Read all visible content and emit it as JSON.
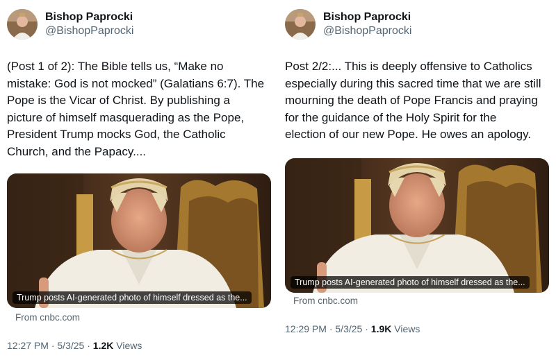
{
  "posts": [
    {
      "author": {
        "name": "Bishop Paprocki",
        "handle": "@BishopPaprocki"
      },
      "text": "(Post 1 of 2): The Bible tells us, “Make no\nmistake: God is not mocked” (Galatians 6:7). The\nPope is the Vicar of Christ. By publishing a\npicture of himself masquerading as the Pope,\nPresident Trump mocks God, the Catholic\nChurch, and the Papacy....",
      "card": {
        "caption": "Trump posts AI-generated photo of himself dressed as the...",
        "source": "From cnbc.com"
      },
      "meta": {
        "time": "12:27 PM",
        "date": "5/3/25",
        "views_count": "1.2K",
        "views_label": "Views"
      }
    },
    {
      "author": {
        "name": "Bishop Paprocki",
        "handle": "@BishopPaprocki"
      },
      "text": "Post 2/2:... This is deeply offensive to Catholics\nespecially during this sacred time that we are still\nmourning the death of Pope Francis and praying\nfor the guidance of the Holy Spirit for the\nelection of our new Pope. He owes an apology.",
      "card": {
        "caption": "Trump posts AI-generated photo of himself dressed as the...",
        "source": "From cnbc.com"
      },
      "meta": {
        "time": "12:29 PM",
        "date": "5/3/25",
        "views_count": "1.9K",
        "views_label": "Views"
      }
    }
  ],
  "separator": "·",
  "colors": {
    "text": "#0f1419",
    "secondary": "#536471",
    "background": "#ffffff"
  }
}
